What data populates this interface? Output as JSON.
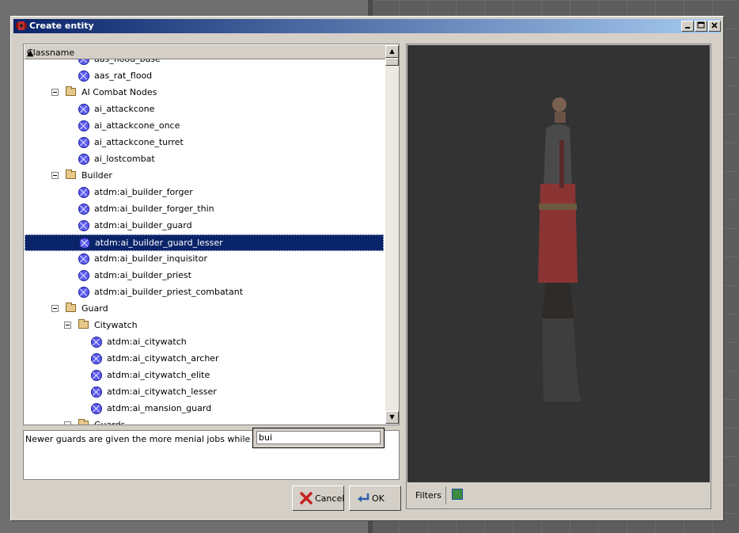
{
  "window": {
    "title": "Create entity"
  },
  "tree": {
    "column_header": "Classname",
    "rows": [
      {
        "label": "aas_flood_base",
        "kind": "entity",
        "depth": 2
      },
      {
        "label": "aas_rat_flood",
        "kind": "entity",
        "depth": 2
      },
      {
        "label": "AI Combat Nodes",
        "kind": "folder",
        "depth": 1
      },
      {
        "label": "ai_attackcone",
        "kind": "entity",
        "depth": 2
      },
      {
        "label": "ai_attackcone_once",
        "kind": "entity",
        "depth": 2
      },
      {
        "label": "ai_attackcone_turret",
        "kind": "entity",
        "depth": 2
      },
      {
        "label": "ai_lostcombat",
        "kind": "entity",
        "depth": 2
      },
      {
        "label": "Builder",
        "kind": "folder",
        "depth": 1
      },
      {
        "label": "atdm:ai_builder_forger",
        "kind": "entity",
        "depth": 2
      },
      {
        "label": "atdm:ai_builder_forger_thin",
        "kind": "entity",
        "depth": 2
      },
      {
        "label": "atdm:ai_builder_guard",
        "kind": "entity",
        "depth": 2
      },
      {
        "label": "atdm:ai_builder_guard_lesser",
        "kind": "entity",
        "depth": 2,
        "selected": true
      },
      {
        "label": "atdm:ai_builder_inquisitor",
        "kind": "entity",
        "depth": 2
      },
      {
        "label": "atdm:ai_builder_priest",
        "kind": "entity",
        "depth": 2
      },
      {
        "label": "atdm:ai_builder_priest_combatant",
        "kind": "entity",
        "depth": 2
      },
      {
        "label": "Guard",
        "kind": "folder",
        "depth": 1
      },
      {
        "label": "Citywatch",
        "kind": "folder",
        "depth": 2
      },
      {
        "label": "atdm:ai_citywatch",
        "kind": "entity",
        "depth": 3
      },
      {
        "label": "atdm:ai_citywatch_archer",
        "kind": "entity",
        "depth": 3
      },
      {
        "label": "atdm:ai_citywatch_elite",
        "kind": "entity",
        "depth": 3
      },
      {
        "label": "atdm:ai_citywatch_lesser",
        "kind": "entity",
        "depth": 3
      },
      {
        "label": "atdm:ai_mansion_guard",
        "kind": "entity",
        "depth": 3
      },
      {
        "label": "Guards",
        "kind": "folder",
        "depth": 2
      }
    ]
  },
  "description": "Newer guards are given the more menial jobs while they ear",
  "search": {
    "value": "bui"
  },
  "buttons": {
    "cancel": "Cancel",
    "ok": "OK"
  },
  "preview": {
    "filters_label": "Filters"
  },
  "colors": {
    "selection": "#0a246a",
    "viewport": "#333333",
    "entity_icon": "#5b5bf0"
  }
}
